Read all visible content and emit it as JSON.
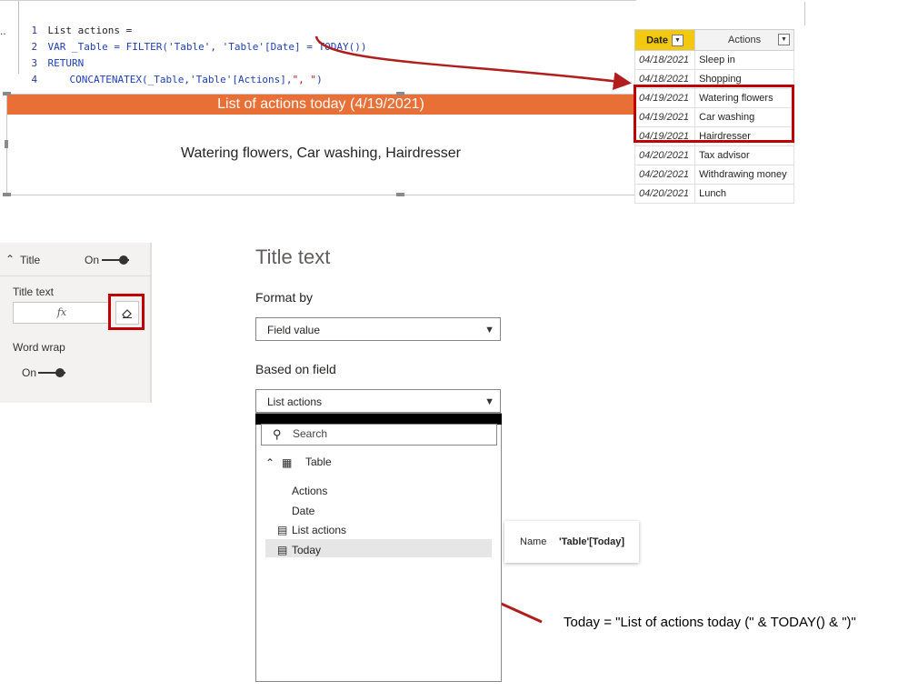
{
  "code": {
    "lines": [
      {
        "num": "1",
        "text": "List actions ="
      },
      {
        "num": "2",
        "kw": "VAR",
        "var": " _Table = ",
        "fn": "FILTER",
        "rest1": "('Table', 'Table'[Date] = ",
        "fn2": "TODAY",
        "rest2": "())"
      },
      {
        "num": "3",
        "kw": "RETURN"
      },
      {
        "num": "4",
        "fn": "CONCATENATEX",
        "rest1": "(_Table,'Table'[Actions],",
        "str": "\", \"",
        "rest2": ")"
      }
    ],
    "ellipsis": ".."
  },
  "card": {
    "title": "List of actions today (4/19/2021)",
    "value": "Watering flowers, Car washing, Hairdresser",
    "title_color": "#e86f35"
  },
  "table": {
    "headers": [
      "Date",
      "Actions"
    ],
    "rows": [
      {
        "date": "04/18/2021",
        "action": "Sleep in"
      },
      {
        "date": "04/18/2021",
        "action": "Shopping"
      },
      {
        "date": "04/19/2021",
        "action": "Watering flowers"
      },
      {
        "date": "04/19/2021",
        "action": "Car washing"
      },
      {
        "date": "04/19/2021",
        "action": "Hairdresser"
      },
      {
        "date": "04/20/2021",
        "action": "Tax advisor"
      },
      {
        "date": "04/20/2021",
        "action": "Withdrawing money"
      },
      {
        "date": "04/20/2021",
        "action": "Lunch"
      }
    ],
    "header_color": "#f2c811",
    "highlight_color": "#c00000"
  },
  "format_pane": {
    "section": "Title",
    "section_toggle": "On",
    "title_text_label": "Title text",
    "fx": "fx",
    "word_wrap_label": "Word wrap",
    "word_wrap_toggle": "On"
  },
  "dialog": {
    "heading": "Title text",
    "format_by_label": "Format by",
    "format_by_value": "Field value",
    "based_on_label": "Based on field",
    "based_on_value": "List actions",
    "search_placeholder": "Search",
    "tree": {
      "table": "Table",
      "fields": [
        "Actions",
        "Date"
      ],
      "measures": [
        "List actions",
        "Today"
      ]
    }
  },
  "tooltip": {
    "name_label": "Name",
    "name_value": "'Table'[Today]"
  },
  "annotation": {
    "formula": "Today = \"List of actions today (\" & TODAY() & \")\"",
    "arrow_color": "#b01e1e"
  }
}
